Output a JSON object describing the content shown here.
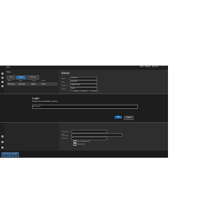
{
  "app": {
    "title": "Bots",
    "topbar_right": [
      "Help",
      "Settings",
      "Sign Out"
    ]
  },
  "left_panel": {
    "header": "Bots",
    "tabs": [
      "Bots",
      "Tasks",
      "Schedules"
    ],
    "grid_headers": [
      "Name",
      "Type",
      "Owner",
      "Status"
    ],
    "rows": [
      {
        "name": "BotDemo1",
        "type": "Attended",
        "owner": "Admin",
        "status": "Online"
      }
    ]
  },
  "detail": {
    "title": "Edit Bot",
    "fields": [
      {
        "label": "Name",
        "value": "BotDemo1"
      },
      {
        "label": "Type",
        "value": "Attended"
      },
      {
        "label": "Machine",
        "value": "DESKTOP-01"
      },
      {
        "label": "Owner",
        "value": "Admin"
      }
    ],
    "table_headers": [
      "Enabled",
      "Parameter",
      "Description"
    ],
    "lower_fields": [
      {
        "label": "Description",
        "value": ""
      },
      {
        "label": "Start Parameters",
        "value": ""
      },
      {
        "label": "Schedule",
        "value": ""
      }
    ],
    "checks": [
      "Run as administrator",
      "Keep log file"
    ],
    "next_label": "Next"
  },
  "dialog": {
    "title": "Login",
    "message": "Please enter credentials to continue",
    "input_value": "Password",
    "ok_label": "OK",
    "cancel_label": "Cancel"
  },
  "status_buttons": [
    "Auto Start",
    "Stop All"
  ],
  "colors": {
    "accent": "#1f6fb2",
    "background": "#2b2b2b",
    "panel": "#262626"
  }
}
